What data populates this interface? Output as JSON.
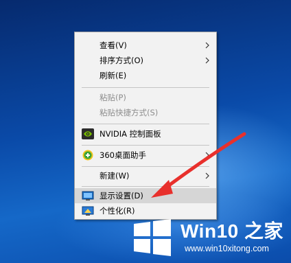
{
  "context_menu": {
    "items": [
      {
        "label": "查看(V)",
        "submenu": true
      },
      {
        "label": "排序方式(O)",
        "submenu": true
      },
      {
        "label": "刷新(E)"
      },
      {
        "label": "粘贴(P)",
        "disabled": true
      },
      {
        "label": "粘贴快捷方式(S)",
        "disabled": true
      },
      {
        "label": "NVIDIA 控制面板",
        "icon": "nvidia-icon"
      },
      {
        "label": "360桌面助手",
        "icon": "360-assistant-icon",
        "submenu": true
      },
      {
        "label": "新建(W)",
        "submenu": true
      },
      {
        "label": "显示设置(D)",
        "icon": "display-settings-icon",
        "highlighted": true
      },
      {
        "label": "个性化(R)",
        "icon": "personalize-icon"
      }
    ]
  },
  "watermark": {
    "title": "Win10 之家",
    "url": "www.win10xitong.com"
  },
  "colors": {
    "menu_bg": "#f2f2f2",
    "highlight": "#d6d6d6",
    "arrow": "#e8302c",
    "desktop": "#0a4aa8"
  }
}
